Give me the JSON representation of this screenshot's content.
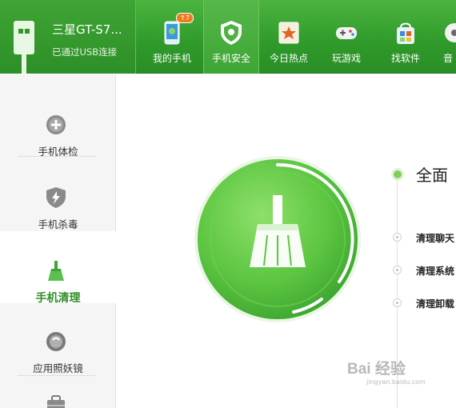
{
  "device": {
    "name": "三星GT-S7...",
    "status": "已通过USB连接"
  },
  "nav": {
    "tabs": [
      {
        "label": "我的手机",
        "icon": "my-phone-icon",
        "badge": "↑7"
      },
      {
        "label": "手机安全",
        "icon": "shield-icon",
        "active": true
      },
      {
        "label": "今日热点",
        "icon": "star-icon"
      },
      {
        "label": "玩游戏",
        "icon": "gamepad-icon"
      },
      {
        "label": "找软件",
        "icon": "shopping-bag-icon"
      },
      {
        "label": "音",
        "icon": "music-icon"
      }
    ]
  },
  "sidebar": {
    "items": [
      {
        "label": "手机体检",
        "icon": "plus-circle-icon"
      },
      {
        "label": "手机杀毒",
        "icon": "lightning-shield-icon"
      },
      {
        "label": "手机清理",
        "icon": "broom-icon",
        "active": true
      },
      {
        "label": "应用照妖镜",
        "icon": "mirror-icon"
      },
      {
        "label": "",
        "icon": "toolbox-icon"
      }
    ]
  },
  "main": {
    "heading": "全面",
    "tasks": [
      "清理聊天",
      "清理系统",
      "清理卸载"
    ]
  },
  "watermark": {
    "text": "Bai 经验",
    "sub": "jingyan.baidu.com"
  },
  "colors": {
    "brand_green": "#2f9a2a",
    "accent_green": "#7ed05a",
    "badge_orange": "#f07a1f"
  }
}
